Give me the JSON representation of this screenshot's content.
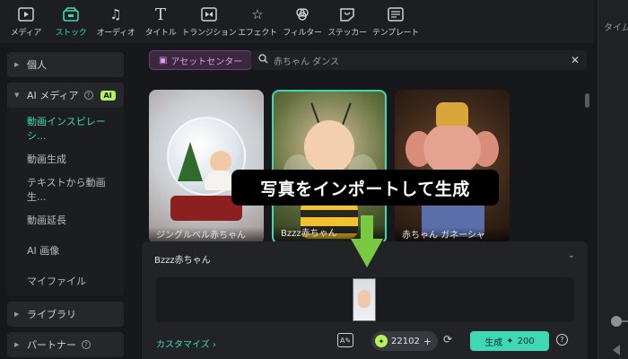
{
  "toolbar": {
    "items": [
      {
        "label": "メディア",
        "icon": "media-icon"
      },
      {
        "label": "ストック",
        "icon": "stock-icon",
        "active": true
      },
      {
        "label": "オーディオ",
        "icon": "audio-icon"
      },
      {
        "label": "タイトル",
        "icon": "title-icon"
      },
      {
        "label": "トランジション",
        "icon": "transition-icon"
      },
      {
        "label": "エフェクト",
        "icon": "effect-icon"
      },
      {
        "label": "フィルター",
        "icon": "filter-icon"
      },
      {
        "label": "ステッカー",
        "icon": "sticker-icon"
      },
      {
        "label": "テンプレート",
        "icon": "template-icon"
      }
    ]
  },
  "right_panel": {
    "title": "タイム"
  },
  "sidebar": {
    "personal": "個人",
    "ai_media": "AI メディア",
    "ai_badge": "AI",
    "ai_items": [
      "動画インスピレーシ...",
      "動画生成",
      "テキストから動画生...",
      "動画延長",
      "AI 画像",
      "マイファイル"
    ],
    "library": "ライブラリ",
    "partner": "パートナー"
  },
  "asset_center": "アセットセンター",
  "search": {
    "value": "赤ちゃん ダンス"
  },
  "cards": [
    {
      "caption": "ジングルベル赤ちゃん"
    },
    {
      "caption": "Bzzz赤ちゃん"
    },
    {
      "caption": "赤ちゃん ガネーシャ"
    }
  ],
  "panel": {
    "title": "Bzzz赤ちゃん",
    "customize": "カスタマイズ ›",
    "credits": "22102",
    "generate_label": "生成",
    "generate_cost": "200"
  },
  "overlay": {
    "text": "写真をインポートして生成"
  },
  "colors": {
    "accent": "#3fd8b4",
    "badge": "#b6f35a",
    "asset": "#e29be8",
    "arrow": "#7ac943"
  }
}
